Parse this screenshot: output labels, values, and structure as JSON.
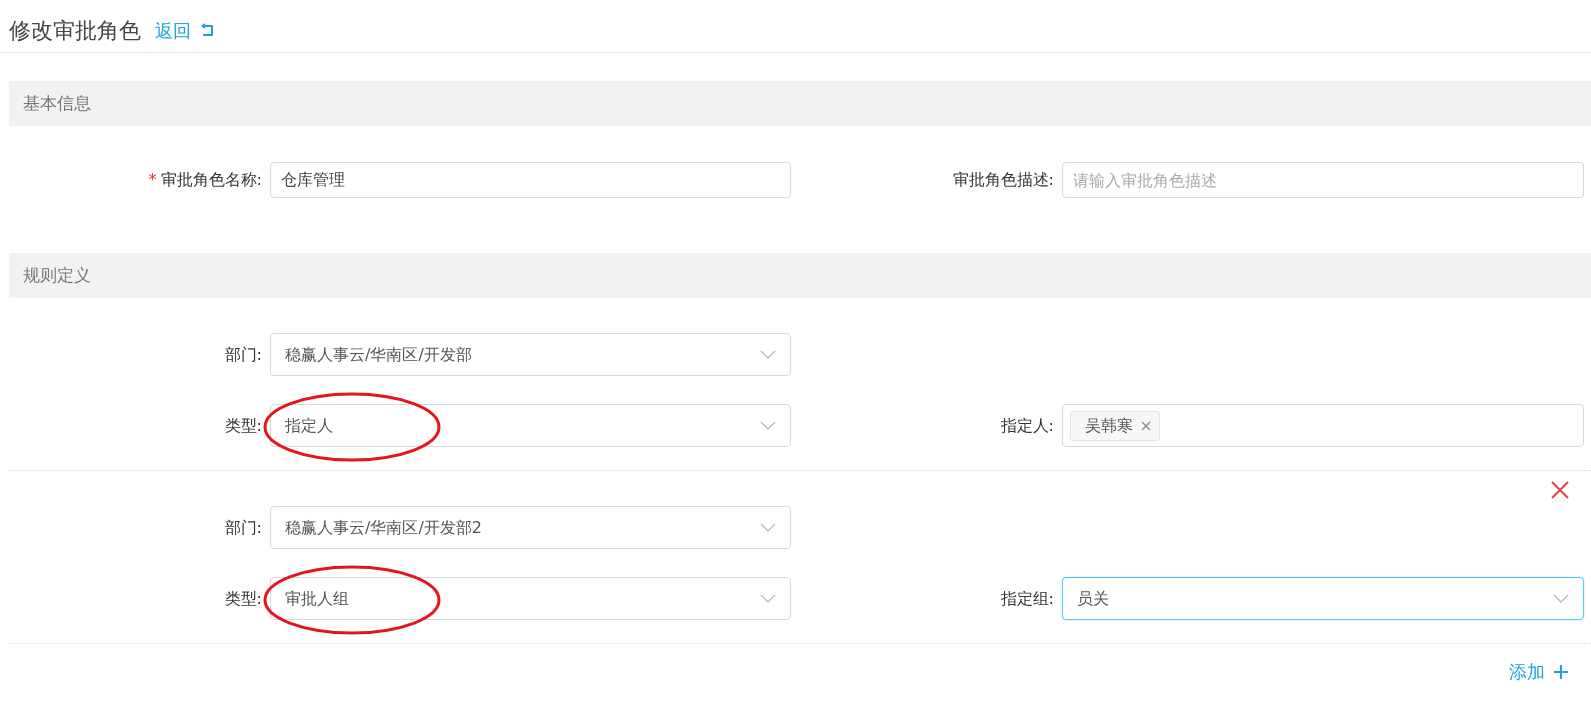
{
  "page": {
    "title": "修改审批角色",
    "back_link": "返回"
  },
  "basic_info": {
    "heading": "基本信息",
    "fields": [
      {
        "required_mark": "*",
        "label": "审批角色名称:",
        "value": "仓库管理"
      },
      {
        "label": "审批角色描述:",
        "placeholder": "请输入审批角色描述"
      }
    ]
  },
  "rules": {
    "heading": "规则定义",
    "items": [
      {
        "removable": false,
        "department": {
          "label": "部门:",
          "value": "稳赢人事云/华南区/开发部"
        },
        "type": {
          "label": "类型:",
          "value": "指定人",
          "annotated": true
        },
        "target": {
          "kind": "tags",
          "label": "指定人:",
          "tags": [
            "吴韩寒"
          ],
          "focused": false
        }
      },
      {
        "removable": true,
        "department": {
          "label": "部门:",
          "value": "稳赢人事云/华南区/开发部2"
        },
        "type": {
          "label": "类型:",
          "value": "审批人组",
          "annotated": true
        },
        "target": {
          "kind": "select",
          "label": "指定组:",
          "value": "员关",
          "focused": true
        }
      }
    ],
    "add_link": "添加"
  }
}
